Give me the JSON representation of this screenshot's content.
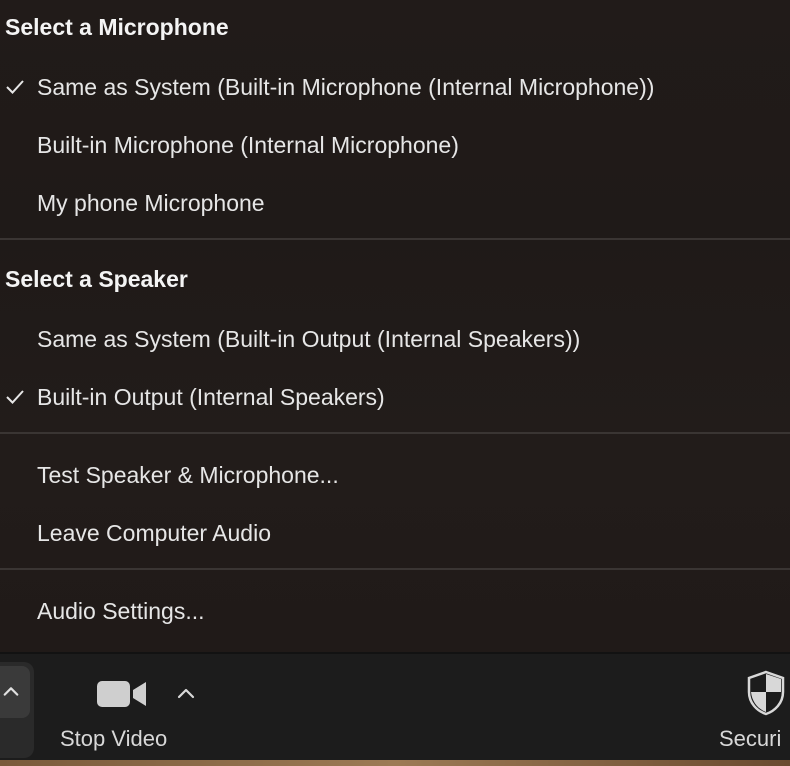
{
  "menu": {
    "microphone_header": "Select a Microphone",
    "microphones": [
      {
        "label": "Same as System (Built-in Microphone (Internal Microphone))",
        "selected": true
      },
      {
        "label": "Built-in Microphone (Internal Microphone)",
        "selected": false
      },
      {
        "label": "My phone  Microphone",
        "selected": false
      }
    ],
    "speaker_header": "Select a Speaker",
    "speakers": [
      {
        "label": "Same as System (Built-in Output (Internal Speakers))",
        "selected": false
      },
      {
        "label": "Built-in Output (Internal Speakers)",
        "selected": true
      }
    ],
    "actions": [
      {
        "label": "Test Speaker & Microphone..."
      },
      {
        "label": "Leave Computer Audio"
      }
    ],
    "settings": {
      "label": "Audio Settings..."
    }
  },
  "toolbar": {
    "stop_video_label": "Stop Video",
    "security_label": "Securi",
    "icons": [
      "chevron-up-icon",
      "video-camera-icon",
      "shield-icon"
    ]
  },
  "colors": {
    "menu_bg": "#211b19",
    "text": "#e6e6e6",
    "separator": "#3a3533",
    "toolbar_bg": "#1c1c1c"
  }
}
